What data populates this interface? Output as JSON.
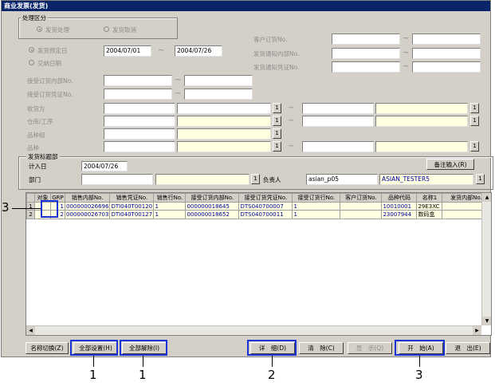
{
  "window": {
    "title": "商业发票(发货)"
  },
  "processing_group": {
    "label": "处理区分",
    "options": [
      "发货处理",
      "发货取消"
    ]
  },
  "date_options": {
    "planned_date": "发货预定日",
    "delivery_date": "交纳日期",
    "date_from": "2004/07/01",
    "tilde": "~",
    "date_to": "2004/07/26"
  },
  "right_fields": [
    "客户订货No.",
    "发货通知内部No.",
    "发货通知凭证No."
  ],
  "order_labels": [
    "接受订货内部No.",
    "接受订货凭证No."
  ],
  "filter_labels": [
    "收货方",
    "仓库/工序",
    "品种组",
    "品种"
  ],
  "header_group": {
    "label": "发货标题部",
    "entry_date_label": "计入日",
    "entry_date": "2004/07/26",
    "dept_label": "部门",
    "manager_label": "负责人",
    "manager_code": "asian_p05",
    "manager_name": "ASIAN_TESTER5",
    "remarks_button": "备注输入(R)"
  },
  "grid": {
    "columns": [
      "对象",
      "GRP",
      "销售内部No.",
      "销售凭证No.",
      "销售行No.",
      "接受订货内部No.",
      "接受订货凭证No.",
      "接受订货行No.",
      "客户订货No.",
      "品种代码",
      "名称1",
      "发货内部No."
    ],
    "rows": [
      [
        "1",
        "",
        "1",
        "000000026696",
        "DTI040T00120",
        "1",
        "000000018645",
        "DTS040700007",
        "1",
        "",
        "10010001",
        "29E3XC",
        ""
      ],
      [
        "2",
        "",
        "2",
        "000000026703",
        "DTI040T00127",
        "1",
        "000000018652",
        "DTS040700011",
        "1",
        "",
        "23007944",
        "数码盒",
        ""
      ]
    ]
  },
  "buttons": {
    "name_switch": "名称切换(Z)",
    "select_all": "全部设置(H)",
    "deselect_all": "全部解除(I)",
    "detail": "详　细(D)",
    "clear": "清　除(C)",
    "display": "显　示(Q)",
    "start": "开　始(A)",
    "exit": "退　出(E)"
  },
  "mini_button_glyph": "1",
  "callouts": [
    "3",
    "1",
    "1",
    "2",
    "3"
  ],
  "colors": {
    "highlight": "#1a33d6",
    "titlebar": "#0a246a",
    "yellow_field": "#ffffe1"
  }
}
